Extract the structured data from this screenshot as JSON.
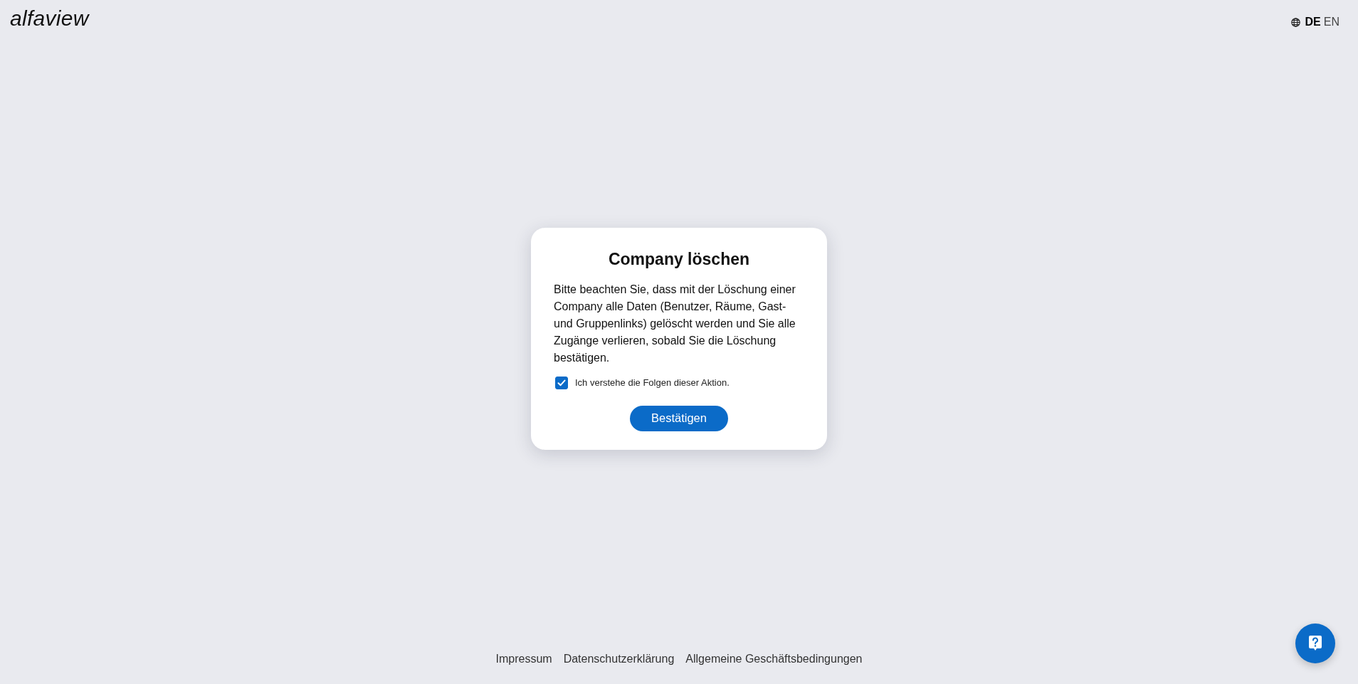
{
  "header": {
    "logo": "alfaview",
    "languages": [
      {
        "label": "DE",
        "selected": true
      },
      {
        "label": "EN",
        "selected": false
      }
    ]
  },
  "dialog": {
    "title": "Company löschen",
    "message": "Bitte beachten Sie, dass mit der Löschung einer Company alle Daten (Benutzer, Räume, Gast- und Gruppenlinks) gelöscht werden und Sie alle Zugänge verlieren, sobald Sie die Löschung bestätigen.",
    "checkbox": {
      "label": "Ich verstehe die Folgen dieser Aktion.",
      "checked": true
    },
    "button": "Bestätigen"
  },
  "footer": {
    "links": [
      "Impressum",
      "Datenschutzerklärung",
      "Allgemeine Geschäftsbedingungen"
    ]
  }
}
